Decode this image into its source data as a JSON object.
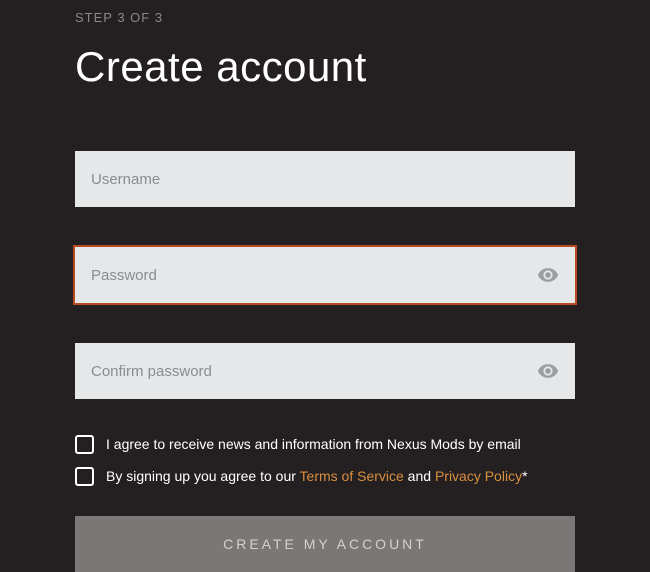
{
  "step": "STEP 3 OF 3",
  "title": "Create account",
  "form": {
    "username": {
      "placeholder": "Username"
    },
    "password": {
      "placeholder": "Password"
    },
    "confirm": {
      "placeholder": "Confirm password"
    }
  },
  "consent": {
    "news": "I agree to receive news and information from Nexus Mods by email",
    "terms_prefix": "By signing up you agree to our ",
    "terms_link": "Terms of Service",
    "terms_and": " and ",
    "privacy_link": "Privacy Policy",
    "asterisk": "*"
  },
  "submit_label": "CREATE MY ACCOUNT"
}
